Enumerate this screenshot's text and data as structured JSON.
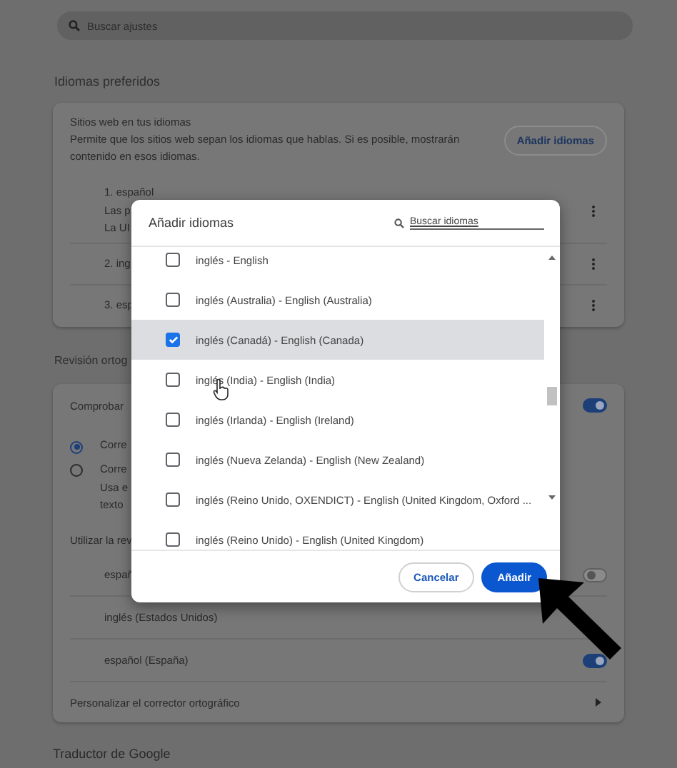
{
  "search": {
    "placeholder": "Buscar ajustes"
  },
  "preferred_languages": {
    "title": "Idiomas preferidos",
    "card": {
      "title": "Sitios web en tus idiomas",
      "description": "Permite que los sitios web sepan los idiomas que hablas. Si es posible, mostrarán contenido en esos idiomas.",
      "button": "Añadir idiomas",
      "languages": [
        {
          "lines": [
            "1. español",
            "Las p",
            "La UI"
          ]
        },
        {
          "lines": [
            "2. ing"
          ]
        },
        {
          "lines": [
            "3. esp"
          ]
        }
      ]
    }
  },
  "spellcheck": {
    "title": "Revisión ortog",
    "check": {
      "label": "Comprobar",
      "on": true
    },
    "options": [
      {
        "lines": [
          "Corre"
        ],
        "selected": true
      },
      {
        "lines": [
          "Corre",
          "Usa e",
          "texto"
        ],
        "selected": false
      }
    ],
    "use_label": "Utilizar la rev",
    "languages": [
      {
        "label": "españ",
        "on": false
      },
      {
        "label": "inglés (Estados Unidos)"
      },
      {
        "label": "español (España)",
        "on": true
      }
    ],
    "customize": "Personalizar el corrector ortográfico"
  },
  "translate_title": "Traductor de Google",
  "dialog": {
    "title": "Añadir idiomas",
    "search": {
      "placeholder": "Buscar idiomas"
    },
    "items": [
      {
        "label": "inglés - English",
        "checked": false,
        "selected": false
      },
      {
        "label": "inglés (Australia) - English (Australia)",
        "checked": false,
        "selected": false
      },
      {
        "label": "inglés (Canadá) - English (Canada)",
        "checked": true,
        "selected": true
      },
      {
        "label": "inglés (India) - English (India)",
        "checked": false,
        "selected": false
      },
      {
        "label": "inglés (Irlanda) - English (Ireland)",
        "checked": false,
        "selected": false
      },
      {
        "label": "inglés (Nueva Zelanda) - English (New Zealand)",
        "checked": false,
        "selected": false
      },
      {
        "label": "inglés (Reino Unido, OXENDICT) - English (United Kingdom, Oxford ...",
        "checked": false,
        "selected": false
      },
      {
        "label": "inglés (Reino Unido) - English (United Kingdom)",
        "checked": false,
        "selected": false
      }
    ],
    "buttons": [
      {
        "label": "Cancelar",
        "kind": "secondary"
      },
      {
        "label": "Añadir",
        "kind": "primary"
      }
    ]
  }
}
